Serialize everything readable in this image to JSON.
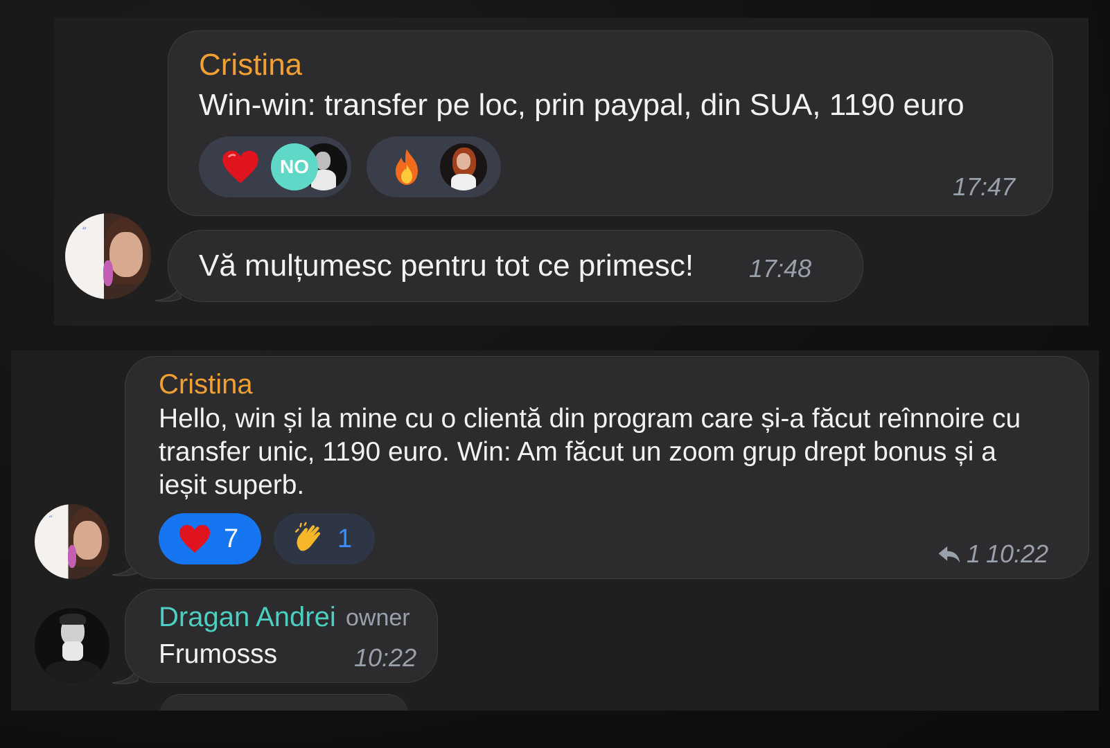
{
  "panel1": {
    "message1": {
      "sender": "Cristina",
      "text": "Win-win: transfer pe loc, prin paypal, din SUA, 1190 euro",
      "time": "17:47",
      "reactions": [
        {
          "emoji": "heart-emoji",
          "avatars": [
            "NO",
            "man-avatar"
          ]
        },
        {
          "emoji": "fire-emoji",
          "avatars": [
            "woman-avatar"
          ]
        }
      ],
      "no_badge": "NO"
    },
    "message2": {
      "text": "Vă mulțumesc pentru tot ce primesc!",
      "time": "17:48"
    }
  },
  "panel2": {
    "message1": {
      "sender": "Cristina",
      "lines": [
        "Hello, win și la mine cu o clientă din program care și-a făcut reînnoire cu",
        "transfer unic, 1190 euro. Win: Am făcut un zoom grup drept bonus și a",
        "ieșit superb."
      ],
      "reactions": [
        {
          "emoji": "heart-emoji",
          "count": "7",
          "selected": true
        },
        {
          "emoji": "clap-emoji",
          "count": "1",
          "selected": false
        }
      ],
      "reply_count": "1",
      "time": "10:22"
    },
    "message2": {
      "sender": "Dragan Andrei",
      "tag": "owner",
      "text": "Frumosss",
      "time": "10:22"
    }
  },
  "colors": {
    "sender_orange": "#f2a033",
    "owner_teal": "#4ccfc0",
    "reaction_blue": "#1676f2",
    "bubble": "#2c2c2e"
  }
}
